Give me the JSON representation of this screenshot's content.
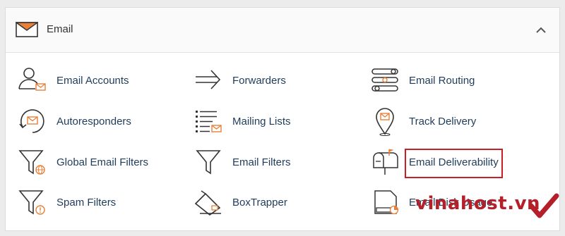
{
  "section": {
    "title": "Email",
    "items": [
      {
        "label": "Email Accounts",
        "icon": "email-accounts-icon"
      },
      {
        "label": "Forwarders",
        "icon": "forwarders-icon"
      },
      {
        "label": "Email Routing",
        "icon": "email-routing-icon"
      },
      {
        "label": "Autoresponders",
        "icon": "autoresponders-icon"
      },
      {
        "label": "Mailing Lists",
        "icon": "mailing-lists-icon"
      },
      {
        "label": "Track Delivery",
        "icon": "track-delivery-icon"
      },
      {
        "label": "Global Email Filters",
        "icon": "global-email-filters-icon"
      },
      {
        "label": "Email Filters",
        "icon": "email-filters-icon"
      },
      {
        "label": "Email Deliverability",
        "icon": "email-deliverability-icon"
      },
      {
        "label": "Spam Filters",
        "icon": "spam-filters-icon"
      },
      {
        "label": "BoxTrapper",
        "icon": "boxtrapper-icon"
      },
      {
        "label": "Email Disk Usage",
        "icon": "email-disk-usage-icon"
      }
    ]
  },
  "watermark": {
    "text": "vinahost.vn"
  },
  "colors": {
    "accent": "#e8803a",
    "text": "#1f3c5a",
    "icon_stroke": "#333333",
    "highlight": "#c81f25",
    "watermark": "#b51f2a"
  }
}
